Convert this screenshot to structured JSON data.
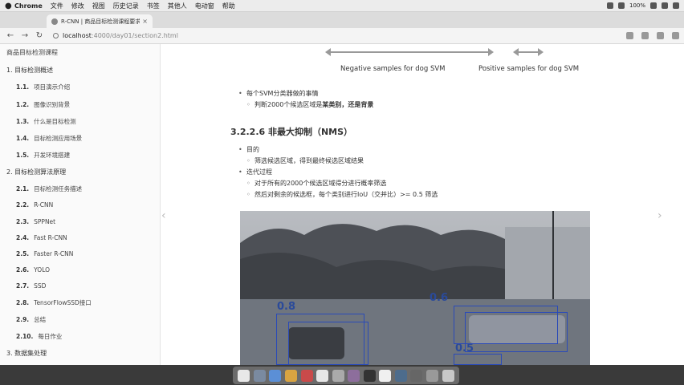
{
  "menubar": {
    "app_name": "Chrome",
    "items": [
      "文件",
      "修改",
      "视图",
      "历史记录",
      "书签",
      "其他人",
      "电动窗",
      "帮助"
    ],
    "battery": "100%"
  },
  "tab": {
    "title": "R-CNN | 商品目标检测课程要求"
  },
  "address": {
    "host": "localhost",
    "path": ":4000/day01/section2.html"
  },
  "sidebar": {
    "book_title": "商品目标检测课程",
    "chapters": [
      {
        "label": "1. 目标检测概述",
        "items": [
          {
            "num": "1.1.",
            "label": "项目演示介绍"
          },
          {
            "num": "1.2.",
            "label": "图像识别背景"
          },
          {
            "num": "1.3.",
            "label": "什么是目标检测"
          },
          {
            "num": "1.4.",
            "label": "目标检测应用场景"
          },
          {
            "num": "1.5.",
            "label": "开发环境搭建"
          }
        ]
      },
      {
        "label": "2. 目标检测算法原理",
        "items": [
          {
            "num": "2.1.",
            "label": "目标检测任务描述"
          },
          {
            "num": "2.2.",
            "label": "R-CNN"
          },
          {
            "num": "2.3.",
            "label": "SPPNet"
          },
          {
            "num": "2.4.",
            "label": "Fast R-CNN"
          },
          {
            "num": "2.5.",
            "label": "Faster R-CNN"
          },
          {
            "num": "2.6.",
            "label": "YOLO"
          },
          {
            "num": "2.7.",
            "label": "SSD"
          },
          {
            "num": "2.8.",
            "label": "TensorFlowSSD接口"
          },
          {
            "num": "2.9.",
            "label": "总结"
          },
          {
            "num": "2.10.",
            "label": "每日作业"
          }
        ]
      },
      {
        "label": "3. 数据集处理",
        "items": []
      }
    ]
  },
  "content": {
    "fig_caption_neg": "Negative samples for dog SVM",
    "fig_caption_pos": "Positive samples for dog SVM",
    "svm_bullet": "每个SVM分类器做的事情",
    "svm_sub_prefix": "判断2000个候选区域是",
    "svm_sub_bold": "某类别，还是背景",
    "nms_heading": "3.2.2.6 非最大抑制（NMS）",
    "goal_label": "目的",
    "goal_sub": "筛选候选区域，得到最终候选区域结果",
    "iter_label": "迭代过程",
    "iter_sub1": "对于所有的2000个候选区域得分进行概率筛选",
    "iter_sub2": "然后对剩余的候选框，每个类别进行IoU（交并比）>= 0.5 筛选",
    "scores": [
      "0.8",
      "0.6",
      "0.5"
    ]
  }
}
